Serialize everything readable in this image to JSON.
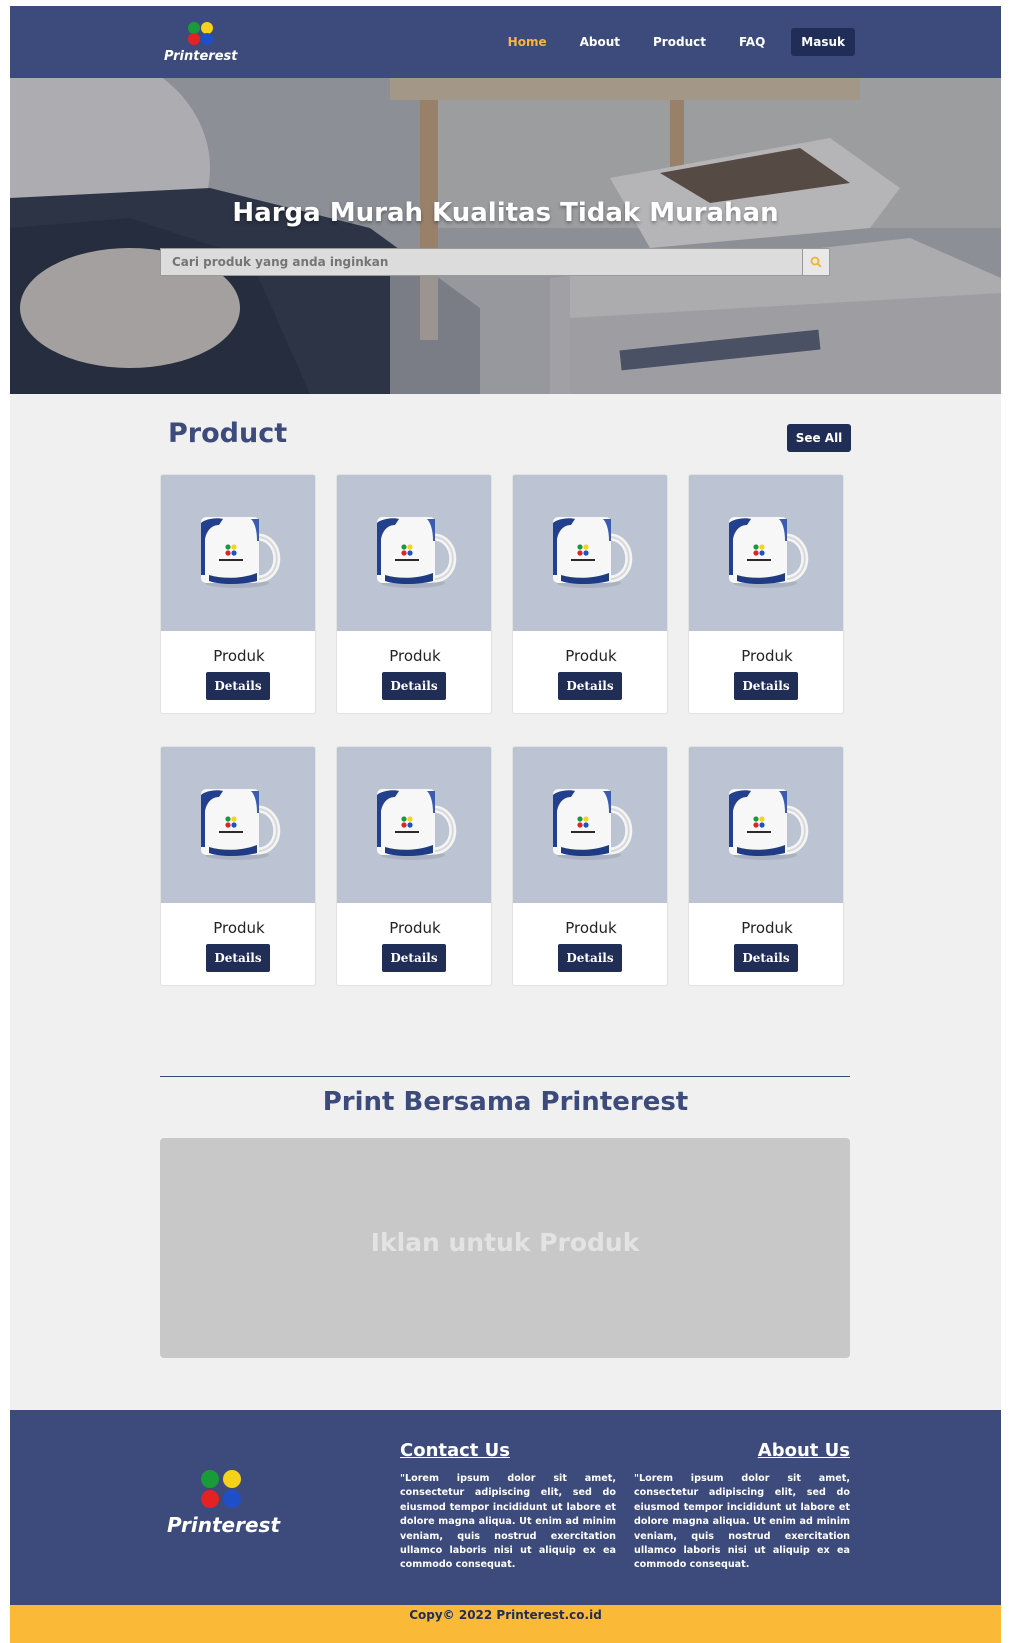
{
  "brand": {
    "name": "Printerest",
    "colors": {
      "green": "#1a9b3a",
      "yellow": "#f6d21a",
      "red": "#e52222",
      "blue": "#1f4fc8"
    }
  },
  "nav": {
    "links": [
      {
        "label": "Home",
        "active": true
      },
      {
        "label": "About",
        "active": false
      },
      {
        "label": "Product",
        "active": false
      },
      {
        "label": "FAQ",
        "active": false
      }
    ],
    "login_label": "Masuk"
  },
  "hero": {
    "title": "Harga Murah Kualitas Tidak Murahan",
    "search_placeholder": "Cari produk yang anda inginkan",
    "search_icon": "search-icon"
  },
  "products": {
    "title": "Product",
    "see_all_label": "See All",
    "items": [
      {
        "name": "Produk",
        "button": "Details"
      },
      {
        "name": "Produk",
        "button": "Details"
      },
      {
        "name": "Produk",
        "button": "Details"
      },
      {
        "name": "Produk",
        "button": "Details"
      },
      {
        "name": "Produk",
        "button": "Details"
      },
      {
        "name": "Produk",
        "button": "Details"
      },
      {
        "name": "Produk",
        "button": "Details"
      },
      {
        "name": "Produk",
        "button": "Details"
      }
    ]
  },
  "promo": {
    "title": "Print Bersama Printerest",
    "ad_text": "Iklan untuk Produk"
  },
  "footer": {
    "contact": {
      "title": "Contact Us",
      "text": "\"Lorem ipsum dolor sit amet, consectetur adipiscing elit, sed do eiusmod tempor incididunt ut labore et dolore magna aliqua. Ut enim ad minim veniam, quis nostrud exercitation ullamco laboris nisi ut aliquip ex ea commodo consequat."
    },
    "about": {
      "title": "About Us",
      "text": "\"Lorem ipsum dolor sit amet, consectetur adipiscing elit, sed do eiusmod tempor incididunt ut labore et dolore magna aliqua. Ut enim ad minim veniam, quis nostrud exercitation ullamco laboris nisi ut aliquip ex ea commodo consequat."
    },
    "copyright": "Copy© 2022 Printerest.co.id"
  }
}
